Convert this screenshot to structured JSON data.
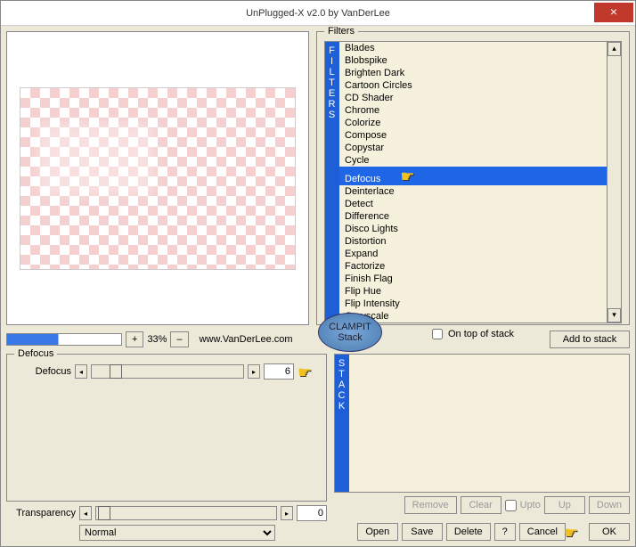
{
  "title": "UnPlugged-X v2.0 by VanDerLee",
  "filters_label": "Filters",
  "filters_vlabel": "FILTERS",
  "filters": [
    "Blades",
    "Blobspike",
    "Brighten Dark",
    "Cartoon Circles",
    "CD Shader",
    "Chrome",
    "Colorize",
    "Compose",
    "Copystar",
    "Cycle",
    "Defocus",
    "Deinterlace",
    "Detect",
    "Difference",
    "Disco Lights",
    "Distortion",
    "Expand",
    "Factorize",
    "Finish Flag",
    "Flip Hue",
    "Flip Intensity",
    "Grayscale"
  ],
  "selected_filter_index": 10,
  "on_top_label": "On top of stack",
  "zoom_pct": "33%",
  "zoom_plus": "+",
  "zoom_minus": "–",
  "url": "www.VanDerLee.com",
  "badge_text1": "CLAMPIT",
  "badge_text2": "Stack",
  "add_to_stack": "Add to stack",
  "defocus_box": "Defocus",
  "param_name": "Defocus",
  "param_value": "6",
  "transparency_label": "Transparency",
  "transparency_value": "0",
  "blend_mode": "Normal",
  "stack_vlabel": "STACK",
  "stack_btns": {
    "remove": "Remove",
    "clear": "Clear",
    "upto": "Upto",
    "up": "Up",
    "down": "Down"
  },
  "main_btns": {
    "open": "Open",
    "save": "Save",
    "delete": "Delete",
    "help": "?",
    "cancel": "Cancel",
    "ok": "OK"
  }
}
